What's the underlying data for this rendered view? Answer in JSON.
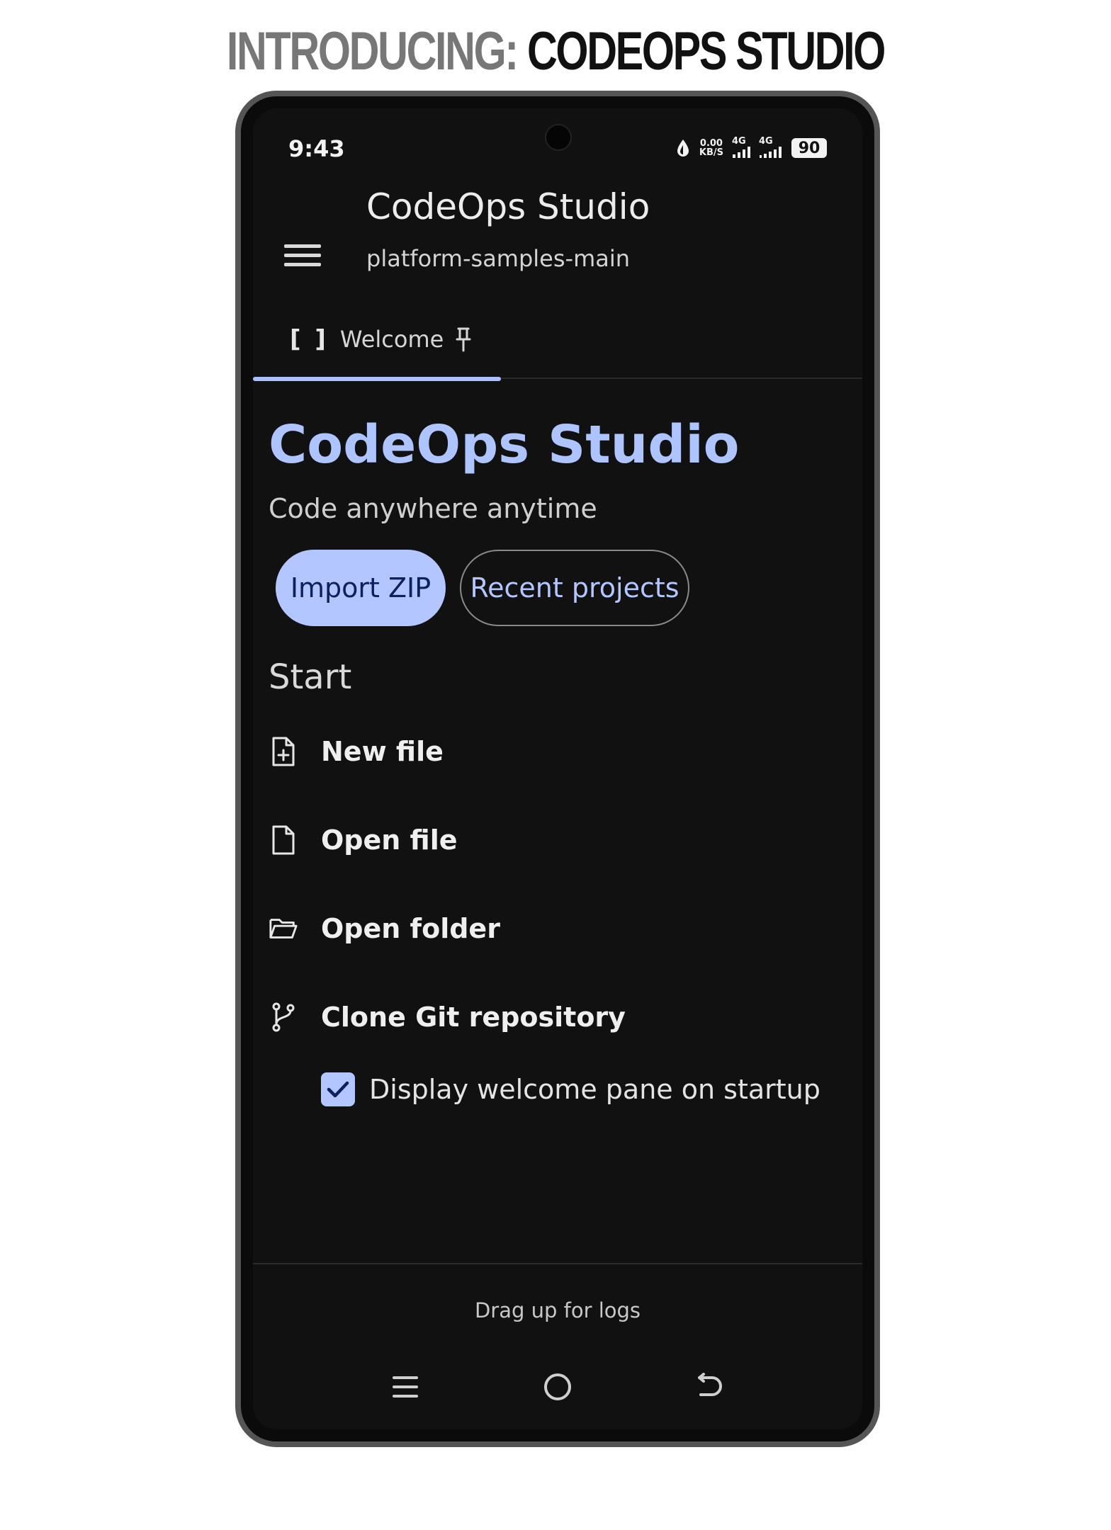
{
  "banner": {
    "prefix": "INTRODUCING:",
    "product": " CODEOPS STUDIO"
  },
  "status_bar": {
    "time": "9:43",
    "net_speed_value": "0.00",
    "net_speed_unit": "KB/S",
    "signal1_label": "4G",
    "signal2_label": "4G",
    "battery": "90"
  },
  "app_bar": {
    "title": "CodeOps Studio",
    "subtitle": "platform-samples-main",
    "menu_icon": "hamburger-menu-icon"
  },
  "tabs": [
    {
      "icon": "[ ]",
      "label": "Welcome",
      "pin_icon": "pin-icon",
      "active": true
    }
  ],
  "welcome": {
    "title": "CodeOps Studio",
    "tagline": "Code anywhere anytime",
    "import_button": "Import ZIP",
    "recent_button": "Recent projects",
    "start_heading": "Start",
    "actions": [
      {
        "label": "New file",
        "icon": "new-file-icon"
      },
      {
        "label": "Open file",
        "icon": "file-icon"
      },
      {
        "label": "Open folder",
        "icon": "folder-open-icon"
      },
      {
        "label": "Clone Git repository",
        "icon": "git-branch-icon"
      }
    ],
    "show_on_startup": {
      "label": "Display welcome pane on startup",
      "checked": true
    }
  },
  "logs_hint": "Drag up for logs",
  "colors": {
    "accent": "#B3C6FF",
    "accent_text": "#AEC4FF",
    "background": "#111111"
  }
}
